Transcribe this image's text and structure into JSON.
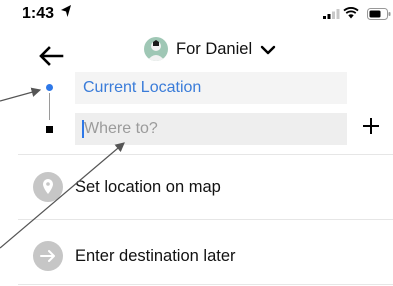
{
  "status_bar": {
    "time": "1:43",
    "icons": [
      "location-arrow-icon",
      "signal-icon",
      "wifi-icon",
      "battery-icon"
    ]
  },
  "header": {
    "back_icon": "back-arrow-icon",
    "rider_label": "For Daniel",
    "dropdown_icon": "chevron-down-icon"
  },
  "trip": {
    "pickup_value": "Current Location",
    "destination_placeholder": "Where to?",
    "add_stop_icon": "plus-icon"
  },
  "options": [
    {
      "label": "Set location on map",
      "icon": "map-pin-icon"
    },
    {
      "label": "Enter destination later",
      "icon": "arrow-right-icon"
    }
  ],
  "colors": {
    "accent_blue": "#2e78e8",
    "field_bg": "#eeeeee",
    "icon_circle": "#c6c6c6",
    "annotation_arrow": "#555555"
  }
}
